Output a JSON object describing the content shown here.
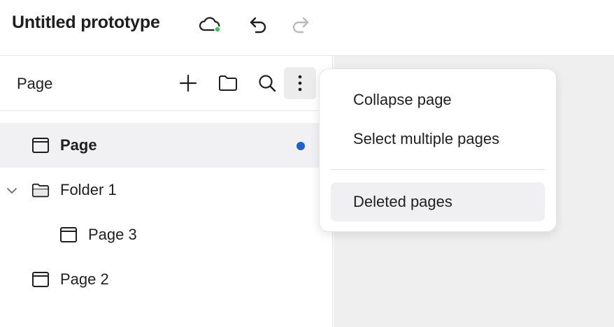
{
  "header": {
    "title": "Untitled prototype",
    "sync_status_color": "#34c759"
  },
  "panel": {
    "title": "Page",
    "icons": [
      "plus-icon",
      "folder-icon",
      "search-icon",
      "more-vertical-icon"
    ]
  },
  "tree": [
    {
      "label": "Page",
      "type": "page",
      "selected": true,
      "active_dot": true
    },
    {
      "label": "Folder 1",
      "type": "folder",
      "expanded": true
    },
    {
      "label": "Page 3",
      "type": "page",
      "child_of": "Folder 1"
    },
    {
      "label": "Page 2",
      "type": "page"
    }
  ],
  "menu": {
    "items": [
      {
        "label": "Collapse page"
      },
      {
        "label": "Select multiple pages"
      },
      {
        "label": "Deleted pages",
        "highlighted": true
      }
    ]
  },
  "colors": {
    "accent_dot": "#1f5fd6",
    "selected_row": "#f1f1f3",
    "canvas": "#efefef"
  }
}
